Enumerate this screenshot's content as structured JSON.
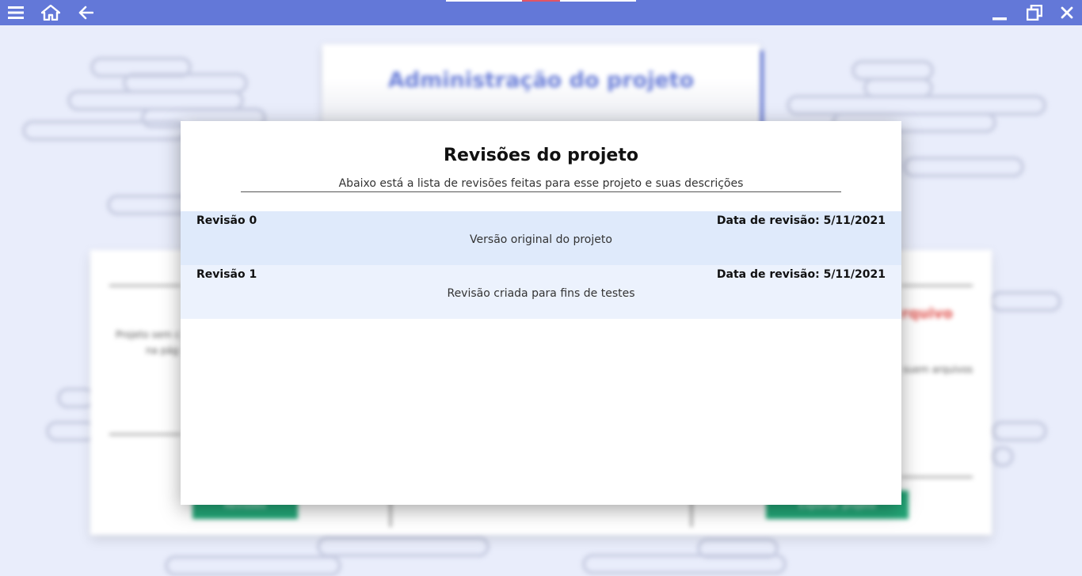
{
  "titlebar": {
    "left_icons": [
      "menu-icon",
      "home-icon",
      "back-arrow-icon"
    ],
    "right_icons": [
      "minimize-icon",
      "restore-icon",
      "close-icon"
    ],
    "bar_color": "#6378d8"
  },
  "background": {
    "admin_title": "Administração do projeto",
    "left_note_line1": "Projeto sem c",
    "left_note_line2": "na pág",
    "right_heading": "rquivo",
    "right_note": "suem arquivos",
    "left_button_label": "Revisões",
    "right_button_label": "Exportar projeto"
  },
  "modal": {
    "title": "Revisões do projeto",
    "subtitle": "Abaixo está a lista de revisões feitas para esse projeto e suas descrições",
    "revisions": [
      {
        "name": "Revisão 0",
        "date_text": "Data de revisão: 5/11/2021",
        "description": "Versão original do projeto"
      },
      {
        "name": "Revisão 1",
        "date_text": "Data de revisão: 5/11/2021",
        "description": "Revisão criada para fins de testes"
      }
    ]
  },
  "colors": {
    "accent": "#6a7ed8",
    "row_odd": "#dfeafb",
    "row_even": "#ecf2fd",
    "warning": "#e0534f",
    "success": "#23a878"
  }
}
